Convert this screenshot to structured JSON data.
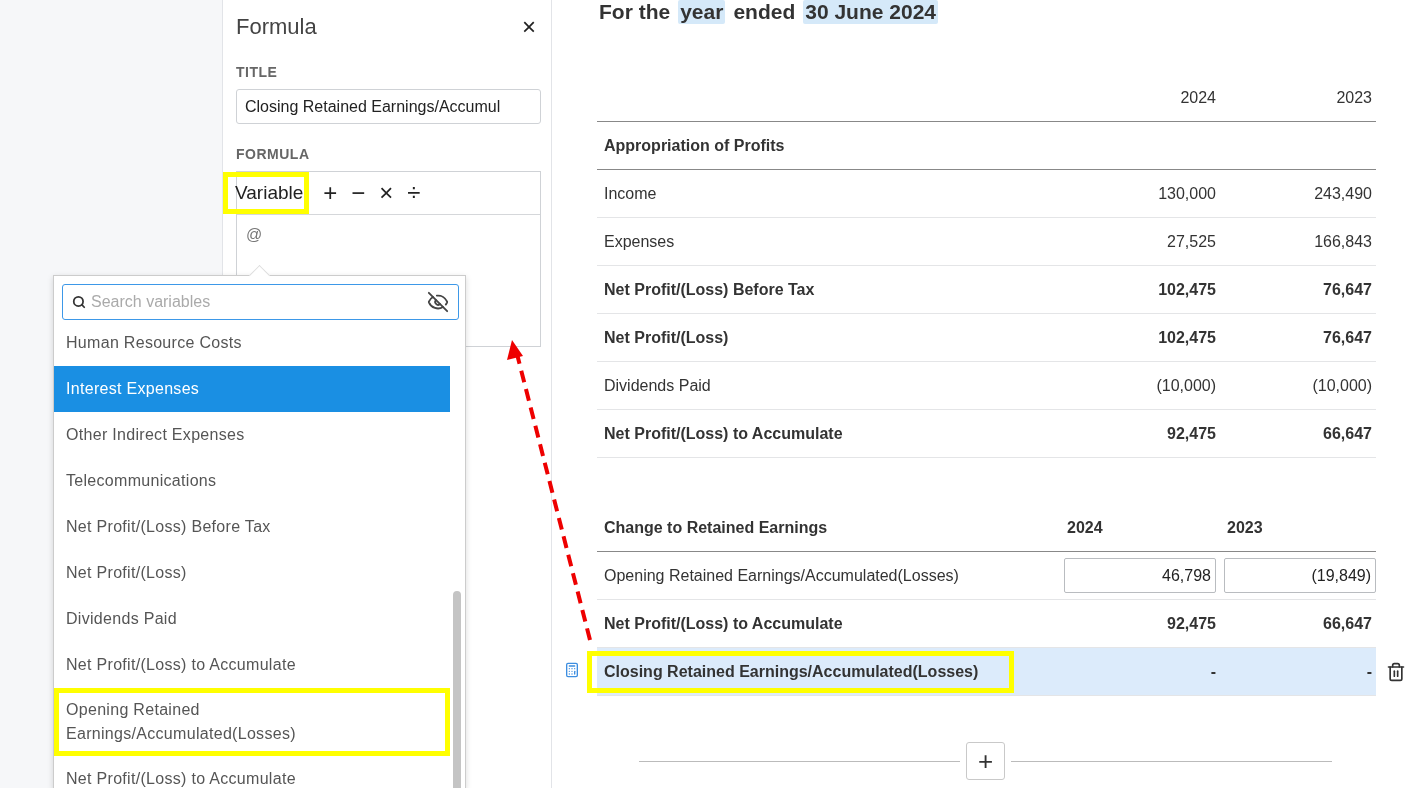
{
  "panel": {
    "title": "Formula",
    "close": "×",
    "title_label": "TITLE",
    "title_value": "Closing Retained Earnings/Accumul",
    "formula_label": "FORMULA",
    "toolbar": [
      {
        "label": "Variable",
        "kind": "word",
        "highlighted": true
      },
      {
        "label": "+",
        "kind": "operator",
        "highlighted": false
      },
      {
        "label": "−",
        "kind": "operator",
        "highlighted": false
      },
      {
        "label": "×",
        "kind": "operator",
        "highlighted": false
      },
      {
        "label": "÷",
        "kind": "operator",
        "highlighted": false
      }
    ],
    "formula_text": "@"
  },
  "variable_menu": {
    "placeholder": "Search variables",
    "items": [
      {
        "label": "Human Resource Costs",
        "selected": false,
        "highlighted": false
      },
      {
        "label": "Interest Expenses",
        "selected": true,
        "highlighted": false
      },
      {
        "label": "Other Indirect Expenses",
        "selected": false,
        "highlighted": false
      },
      {
        "label": "Telecommunications",
        "selected": false,
        "highlighted": false
      },
      {
        "label": "Net Profit/(Loss) Before Tax",
        "selected": false,
        "highlighted": false
      },
      {
        "label": "Net Profit/(Loss)",
        "selected": false,
        "highlighted": false
      },
      {
        "label": "Dividends Paid",
        "selected": false,
        "highlighted": false
      },
      {
        "label": "Net Profit/(Loss) to Accumulate",
        "selected": false,
        "highlighted": false
      },
      {
        "label": "Opening Retained Earnings/Accumulated(Losses)",
        "selected": false,
        "highlighted": true
      },
      {
        "label": "Net Profit/(Loss) to Accumulate",
        "selected": false,
        "highlighted": false
      }
    ]
  },
  "report": {
    "heading_parts": [
      {
        "text": "For the",
        "highlighted": false
      },
      {
        "text": "year",
        "highlighted": true
      },
      {
        "text": "ended",
        "highlighted": false
      },
      {
        "text": "30 June 2024",
        "highlighted": true
      }
    ],
    "appropriation": {
      "columns": [
        "2024",
        "2023"
      ],
      "section": "Appropriation of Profits",
      "rows": [
        {
          "label": "Income",
          "bold": false,
          "values": [
            "130,000",
            "243,490"
          ]
        },
        {
          "label": "Expenses",
          "bold": false,
          "values": [
            "27,525",
            "166,843"
          ]
        },
        {
          "label": "Net Profit/(Loss) Before Tax",
          "bold": true,
          "values": [
            "102,475",
            "76,647"
          ]
        },
        {
          "label": "Net Profit/(Loss)",
          "bold": true,
          "values": [
            "102,475",
            "76,647"
          ]
        },
        {
          "label": "Dividends Paid",
          "bold": false,
          "values": [
            "(10,000)",
            "(10,000)"
          ]
        },
        {
          "label": "Net Profit/(Loss) to Accumulate",
          "bold": true,
          "values": [
            "92,475",
            "66,647"
          ]
        }
      ]
    },
    "retained": {
      "title": "Change to Retained Earnings",
      "columns": [
        "2024",
        "2023"
      ],
      "rows": [
        {
          "label": "Opening Retained Earnings/Accumulated(Losses)",
          "kind": "input",
          "bold": false,
          "selected": false,
          "highlighted": false,
          "values": [
            "46,798",
            "(19,849)"
          ]
        },
        {
          "label": "Net Profit/(Loss) to Accumulate",
          "kind": "value",
          "bold": true,
          "selected": false,
          "highlighted": false,
          "values": [
            "92,475",
            "66,647"
          ]
        },
        {
          "label": "Closing Retained Earnings/Accumulated(Losses)",
          "kind": "formula",
          "bold": true,
          "selected": true,
          "highlighted": true,
          "values": [
            "-",
            "-"
          ]
        }
      ]
    },
    "add_button": "+"
  }
}
